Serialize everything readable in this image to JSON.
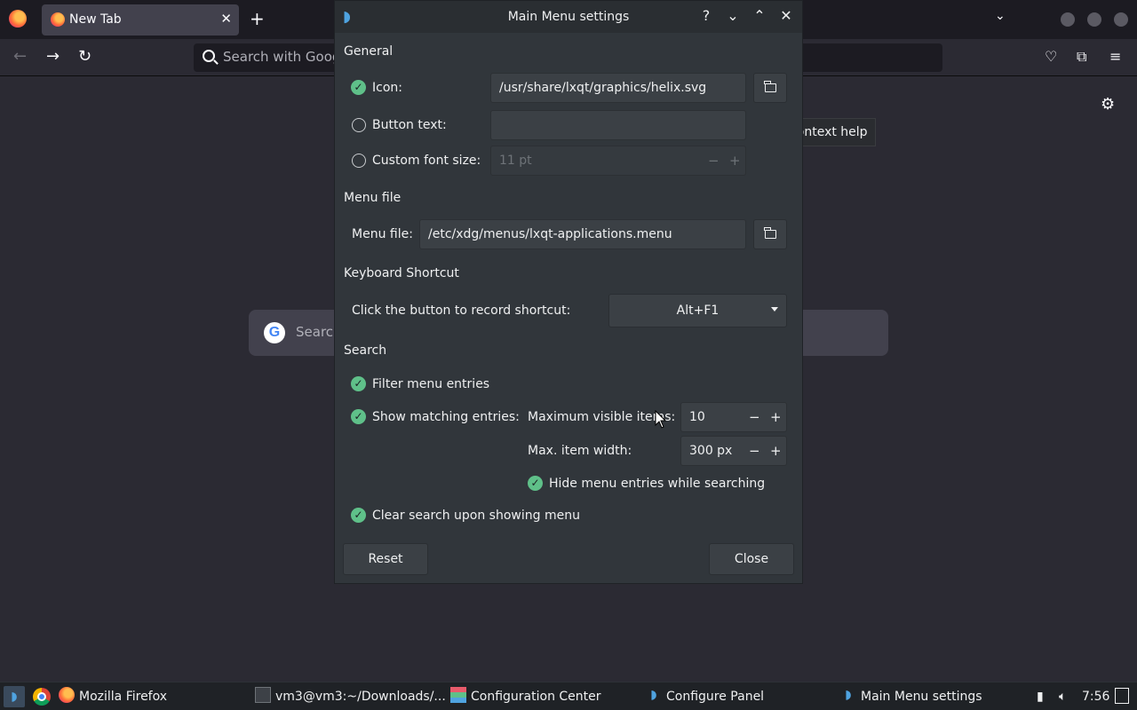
{
  "browser": {
    "tab_title": "New Tab",
    "tab_close": "✕",
    "new_tab": "+",
    "url_placeholder": "Search with Google or enter address",
    "page_search_placeholder": "Search with Google or enter address",
    "google_letter": "G"
  },
  "tooltip": "Context help",
  "dialog": {
    "title": "Main Menu settings",
    "titlebar_buttons": {
      "help": "?",
      "minimize": "⌄",
      "maximize": "⌃",
      "close": "✕"
    },
    "general": {
      "heading": "General",
      "icon_label": "Icon:",
      "icon_value": "/usr/share/lxqt/graphics/helix.svg",
      "button_text_label": "Button text:",
      "button_text_value": "",
      "font_size_label": "Custom font size:",
      "font_size_value": "11 pt"
    },
    "menu_file": {
      "heading": "Menu file",
      "label": "Menu file:",
      "value": "/etc/xdg/menus/lxqt-applications.menu"
    },
    "shortcut": {
      "heading": "Keyboard Shortcut",
      "label": "Click the button to record shortcut:",
      "value": "Alt+F1"
    },
    "search": {
      "heading": "Search",
      "filter_label": "Filter menu entries",
      "show_matching_label": "Show matching entries:",
      "max_visible_label": "Maximum visible items:",
      "max_visible_value": "10",
      "max_width_label": "Max. item width:",
      "max_width_value": "300 px",
      "hide_entries_label": "Hide menu entries while searching",
      "clear_search_label": "Clear search upon showing menu"
    },
    "reset_label": "Reset",
    "close_label": "Close"
  },
  "taskbar": {
    "items": [
      "Mozilla Firefox",
      "vm3@vm3:~/Downloads/...",
      "Configuration Center",
      "Configure Panel",
      "Main Menu settings"
    ],
    "clock": "7:56"
  }
}
